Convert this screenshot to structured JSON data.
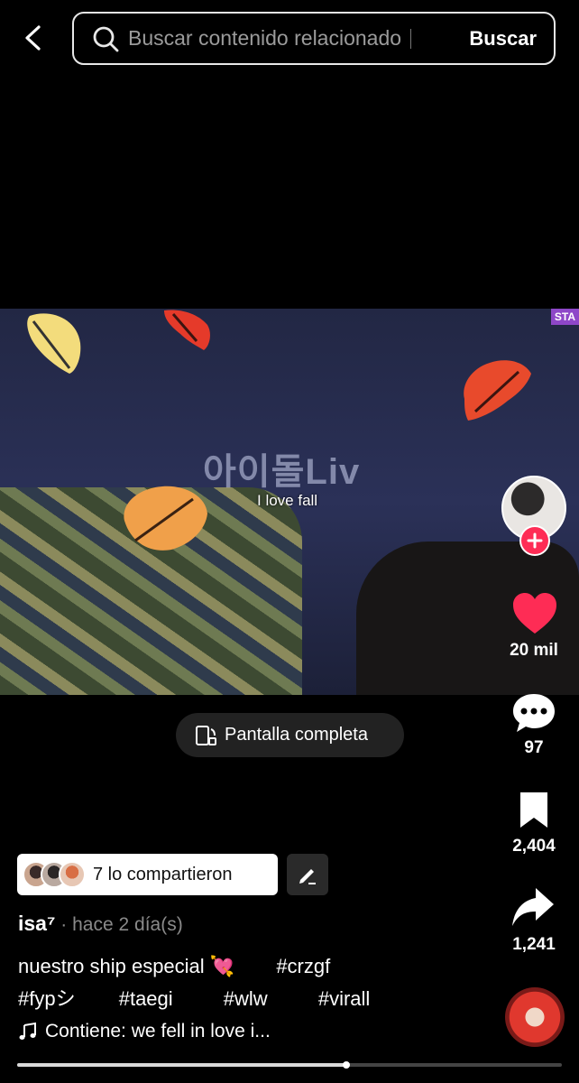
{
  "header": {
    "back_icon": "chevron-left-icon",
    "search": {
      "placeholder": "Buscar contenido relacionado",
      "button_label": "Buscar",
      "icon": "search-icon"
    }
  },
  "video": {
    "banner_text": "아이돌Liv",
    "corner_tag": "STA",
    "caption_overlay": "I love fall"
  },
  "actions": {
    "likes": "20 mil",
    "comments": "97",
    "saves": "2,404",
    "shares": "1,241",
    "like_color": "#fe2c55",
    "follow_color": "#fe2c55"
  },
  "fullscreen": {
    "label": "Pantalla completa",
    "icon": "rotate-screen-icon"
  },
  "shared": {
    "label": "7 lo compartieron",
    "edit_icon": "pencil-icon"
  },
  "author": {
    "name": "isa⁷",
    "meta": " · hace 2 día(s)"
  },
  "description": {
    "text": "nuestro ship especial 💘",
    "tags_line1": [
      "#crzgf"
    ],
    "tags_line2": [
      "#fypシ",
      "#taegi",
      "#wlw",
      "#virall"
    ]
  },
  "music": {
    "label": "Contiene: we fell in love i...",
    "icon": "music-note-icon"
  },
  "progress": {
    "fraction": 0.605
  }
}
